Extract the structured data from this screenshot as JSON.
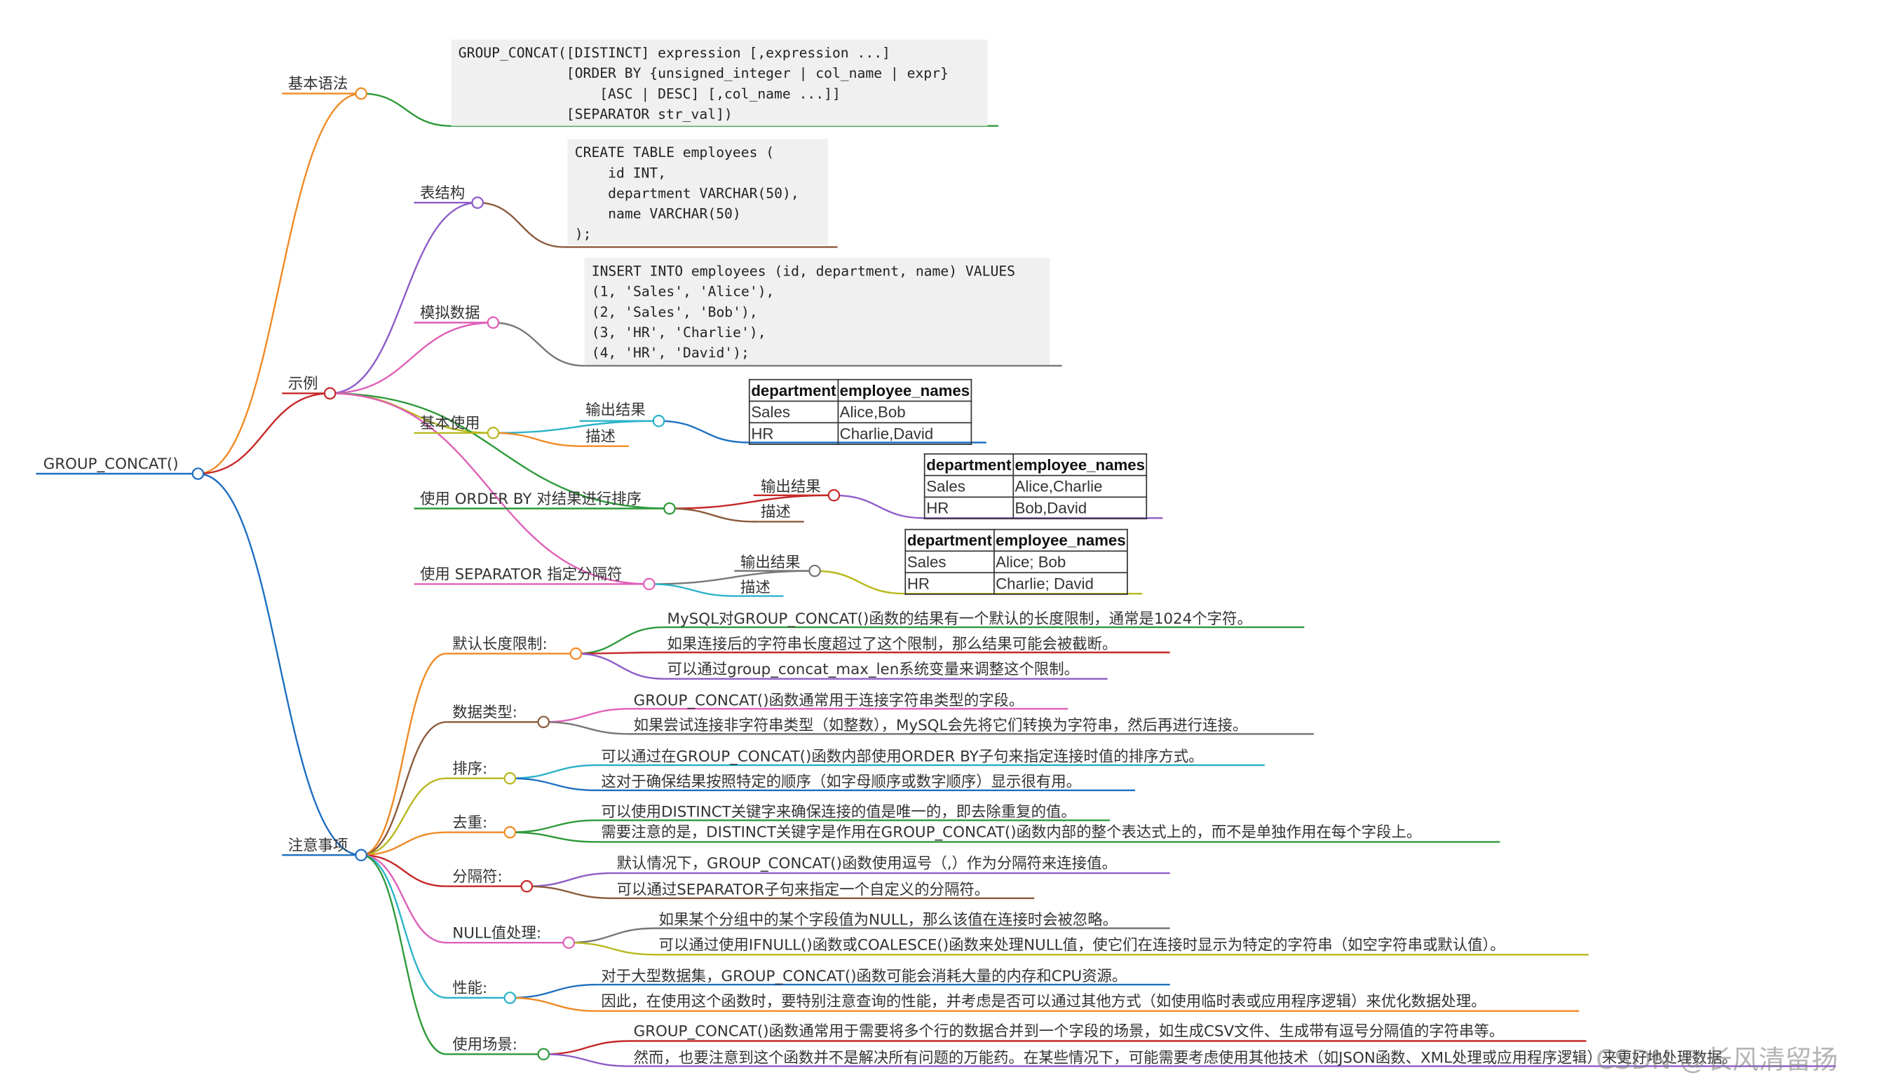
{
  "root": "GROUP_CONCAT()",
  "syntax": {
    "label": "基本语法",
    "code": "GROUP_CONCAT([DISTINCT] expression [,expression ...]\n             [ORDER BY {unsigned_integer | col_name | expr}\n                 [ASC | DESC] [,col_name ...]]\n             [SEPARATOR str_val])"
  },
  "example": {
    "label": "示例",
    "table_structure": {
      "label": "表结构",
      "code": "CREATE TABLE employees (\n    id INT,\n    department VARCHAR(50),\n    name VARCHAR(50)\n);"
    },
    "mock_data": {
      "label": "模拟数据",
      "code": "INSERT INTO employees (id, department, name) VALUES\n(1, 'Sales', 'Alice'),\n(2, 'Sales', 'Bob'),\n(3, 'HR', 'Charlie'),\n(4, 'HR', 'David');"
    },
    "basic_use": {
      "label": "基本使用",
      "output_label": "输出结果",
      "desc_label": "描述",
      "headers": [
        "department",
        "employee_names"
      ],
      "rows": [
        [
          "Sales",
          "Alice,Bob"
        ],
        [
          "HR",
          "Charlie,David"
        ]
      ]
    },
    "order_by": {
      "label": "使用 ORDER BY 对结果进行排序",
      "output_label": "输出结果",
      "desc_label": "描述",
      "headers": [
        "department",
        "employee_names"
      ],
      "rows": [
        [
          "Sales",
          "Alice,Charlie"
        ],
        [
          "HR",
          "Bob,David"
        ]
      ]
    },
    "separator": {
      "label": "使用 SEPARATOR 指定分隔符",
      "output_label": "输出结果",
      "desc_label": "描述",
      "headers": [
        "department",
        "employee_names"
      ],
      "rows": [
        [
          "Sales",
          "Alice; Bob"
        ],
        [
          "HR",
          "Charlie; David"
        ]
      ]
    }
  },
  "notes": {
    "label": "注意事项",
    "groups": [
      {
        "label": "默认长度限制:",
        "items": [
          "MySQL对GROUP_CONCAT()函数的结果有一个默认的长度限制，通常是1024个字符。",
          "如果连接后的字符串长度超过了这个限制，那么结果可能会被截断。",
          "可以通过group_concat_max_len系统变量来调整这个限制。"
        ]
      },
      {
        "label": "数据类型:",
        "items": [
          "GROUP_CONCAT()函数通常用于连接字符串类型的字段。",
          "如果尝试连接非字符串类型（如整数），MySQL会先将它们转换为字符串，然后再进行连接。"
        ]
      },
      {
        "label": "排序:",
        "items": [
          "可以通过在GROUP_CONCAT()函数内部使用ORDER BY子句来指定连接时值的排序方式。",
          "这对于确保结果按照特定的顺序（如字母顺序或数字顺序）显示很有用。"
        ]
      },
      {
        "label": "去重:",
        "items": [
          "可以使用DISTINCT关键字来确保连接的值是唯一的，即去除重复的值。",
          "需要注意的是，DISTINCT关键字是作用在GROUP_CONCAT()函数内部的整个表达式上的，而不是单独作用在每个字段上。"
        ]
      },
      {
        "label": "分隔符:",
        "items": [
          "默认情况下，GROUP_CONCAT()函数使用逗号（,）作为分隔符来连接值。",
          "可以通过SEPARATOR子句来指定一个自定义的分隔符。"
        ]
      },
      {
        "label": "NULL值处理:",
        "items": [
          "如果某个分组中的某个字段值为NULL，那么该值在连接时会被忽略。",
          "可以通过使用IFNULL()函数或COALESCE()函数来处理NULL值，使它们在连接时显示为特定的字符串（如空字符串或默认值）。"
        ]
      },
      {
        "label": "性能:",
        "items": [
          "对于大型数据集，GROUP_CONCAT()函数可能会消耗大量的内存和CPU资源。",
          "因此，在使用这个函数时，要特别注意查询的性能，并考虑是否可以通过其他方式（如使用临时表或应用程序逻辑）来优化数据处理。"
        ]
      },
      {
        "label": "使用场景:",
        "items": [
          "GROUP_CONCAT()函数通常用于需要将多个行的数据合并到一个字段的场景，如生成CSV文件、生成带有逗号分隔值的字符串等。",
          "然而，也要注意到这个函数并不是解决所有问题的万能药。在某些情况下，可能需要考虑使用其他技术（如JSON函数、XML处理或应用程序逻辑）来更好地处理数据。"
        ]
      }
    ]
  },
  "watermark": "CSDN @长风清留扬",
  "colors": {
    "root": "#1e6fc1",
    "syntax": "#f08a24",
    "example": "#c62828",
    "table_structure": "#8e5cc8",
    "mock_data": "#e05fb8",
    "basic_use": "#b8b81c",
    "order_by": "#2e9a3a",
    "separator": "#e05fb8",
    "notes": "#1e6fc1"
  }
}
